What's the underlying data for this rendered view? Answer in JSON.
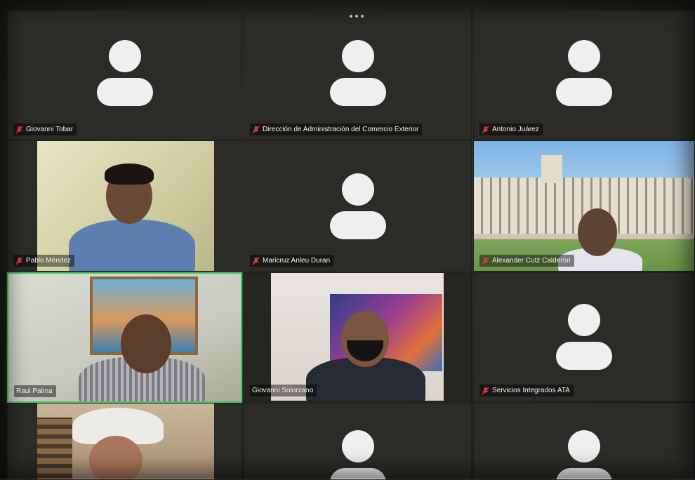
{
  "meeting": {
    "more_menu_icon": "ellipsis-icon",
    "muted_icon": "microphone-muted-icon",
    "active_speaker_color": "#45c463",
    "participants": [
      {
        "name": "Giovanni Tobar",
        "muted": true,
        "video": false
      },
      {
        "name": "Dirección de Administración del Comercio Exterior",
        "muted": true,
        "video": false
      },
      {
        "name": "Antonio Juárez",
        "muted": true,
        "video": false
      },
      {
        "name": "Pablo Méndez",
        "muted": true,
        "video": true
      },
      {
        "name": "Maricruz Anleu Duran",
        "muted": true,
        "video": false
      },
      {
        "name": "Alexander Cutz Calderón",
        "muted": true,
        "video": true
      },
      {
        "name": "Raul Palma",
        "muted": false,
        "video": true,
        "active_speaker": true
      },
      {
        "name": "Giovanni Solorzano",
        "muted": false,
        "video": true
      },
      {
        "name": "Servicios Integrados ATA",
        "muted": true,
        "video": false
      },
      {
        "name": "",
        "muted": false,
        "video": true
      },
      {
        "name": "",
        "muted": false,
        "video": false
      },
      {
        "name": "",
        "muted": false,
        "video": false
      }
    ]
  }
}
